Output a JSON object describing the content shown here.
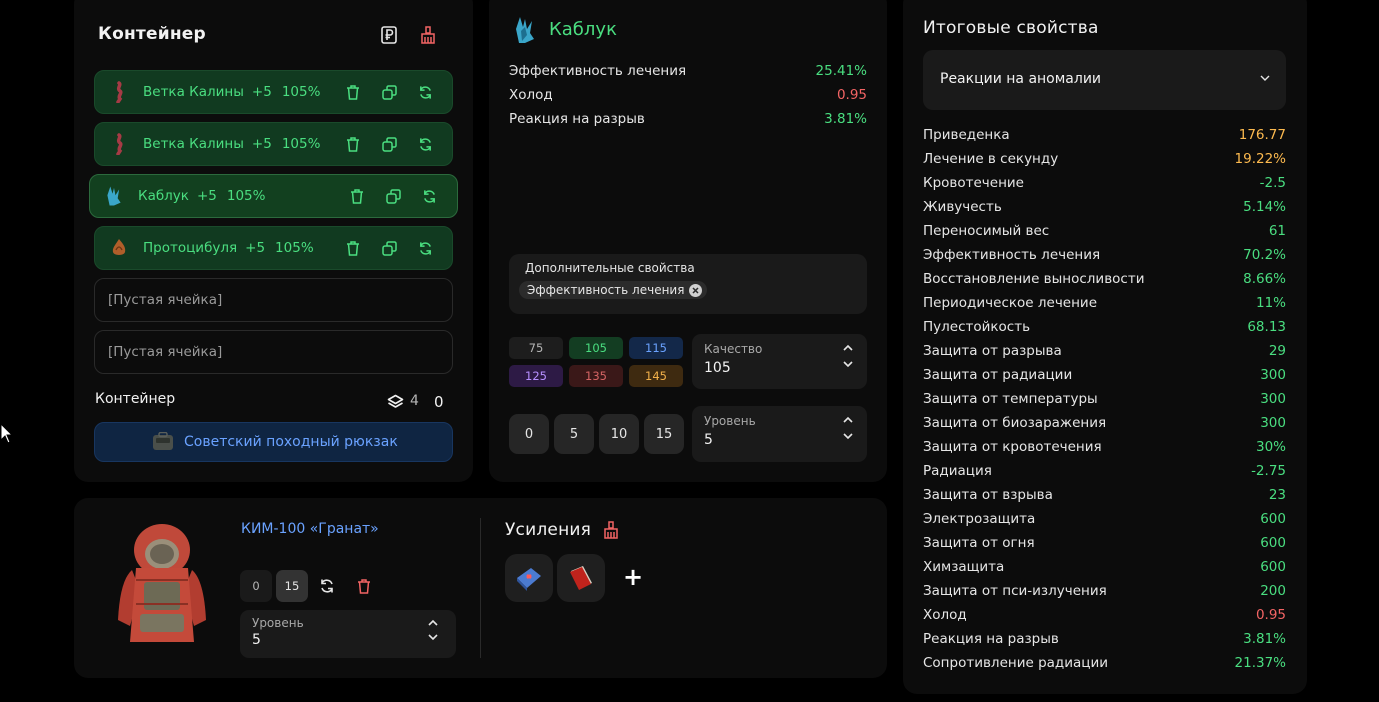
{
  "container": {
    "title": "Контейнер",
    "slots": [
      {
        "name": "Ветка Калины",
        "bonus": "+5",
        "quality": "105%",
        "icon": "branch-icon"
      },
      {
        "name": "Ветка Калины",
        "bonus": "+5",
        "quality": "105%",
        "icon": "branch-icon"
      },
      {
        "name": "Каблук",
        "bonus": "+5",
        "quality": "105%",
        "icon": "crystal-icon"
      },
      {
        "name": "Протоцибуля",
        "bonus": "+5",
        "quality": "105%",
        "icon": "bulb-icon"
      }
    ],
    "empty_slot_label": "[Пустая ячейка]",
    "footer_label": "Контейнер",
    "layers_count": "4",
    "extra_count": "0",
    "backpack_name": "Советский походный рюкзак"
  },
  "artifact": {
    "name": "Каблук",
    "stats": [
      {
        "label": "Эффективность лечения",
        "value": "25.41%",
        "color": "#4ade80"
      },
      {
        "label": "Холод",
        "value": "0.95",
        "color": "#f26464"
      },
      {
        "label": "Реакция на разрыв",
        "value": "3.81%",
        "color": "#4ade80"
      }
    ],
    "extra_props_title": "Дополнительные свойства",
    "extra_chip": "Эффективность лечения",
    "quality_options": [
      {
        "value": "75",
        "bg": "#1d1d1d",
        "color": "#b5b5b5"
      },
      {
        "value": "105",
        "bg": "#133d22",
        "color": "#4ade80"
      },
      {
        "value": "115",
        "bg": "#132849",
        "color": "#6aa2ff"
      },
      {
        "value": "125",
        "bg": "#2d1a45",
        "color": "#b890ff"
      },
      {
        "value": "135",
        "bg": "#3a1818",
        "color": "#d46464"
      },
      {
        "value": "145",
        "bg": "#3e2a10",
        "color": "#f2b04a"
      }
    ],
    "quality_label": "Качество",
    "quality_value": "105",
    "level_buttons": [
      "0",
      "5",
      "10",
      "15"
    ],
    "level_label": "Уровень",
    "level_value": "5"
  },
  "armor": {
    "name": "КИМ-100 «Гранат»",
    "level_min": "0",
    "level_max": "15",
    "level_label": "Уровень",
    "level_value": "5"
  },
  "boosts": {
    "title": "Усиления",
    "add_label": "+"
  },
  "summary": {
    "title": "Итоговые свойства",
    "dropdown_value": "Реакции на аномалии",
    "rows": [
      {
        "label": "Приведенка",
        "value": "176.77",
        "color": "#fdba4f"
      },
      {
        "label": "Лечение в секунду",
        "value": "19.22%",
        "color": "#fdba4f"
      },
      {
        "label": "Кровотечение",
        "value": "-2.5",
        "color": "#4ade80"
      },
      {
        "label": "Живучесть",
        "value": "5.14%",
        "color": "#4ade80"
      },
      {
        "label": "Переносимый вес",
        "value": "61",
        "color": "#4ade80"
      },
      {
        "label": "Эффективность лечения",
        "value": "70.2%",
        "color": "#4ade80"
      },
      {
        "label": "Восстановление выносливости",
        "value": "8.66%",
        "color": "#4ade80"
      },
      {
        "label": "Периодическое лечение",
        "value": "11%",
        "color": "#4ade80"
      },
      {
        "label": "Пулестойкость",
        "value": "68.13",
        "color": "#4ade80"
      },
      {
        "label": "Защита от разрыва",
        "value": "29",
        "color": "#4ade80"
      },
      {
        "label": "Защита от радиации",
        "value": "300",
        "color": "#4ade80"
      },
      {
        "label": "Защита от температуры",
        "value": "300",
        "color": "#4ade80"
      },
      {
        "label": "Защита от биозаражения",
        "value": "300",
        "color": "#4ade80"
      },
      {
        "label": "Защита от кровотечения",
        "value": "30%",
        "color": "#4ade80"
      },
      {
        "label": "Радиация",
        "value": "-2.75",
        "color": "#4ade80"
      },
      {
        "label": "Защита от взрыва",
        "value": "23",
        "color": "#4ade80"
      },
      {
        "label": "Электрозащита",
        "value": "600",
        "color": "#4ade80"
      },
      {
        "label": "Защита от огня",
        "value": "600",
        "color": "#4ade80"
      },
      {
        "label": "Химзащита",
        "value": "600",
        "color": "#4ade80"
      },
      {
        "label": "Защита от пси-излучения",
        "value": "200",
        "color": "#4ade80"
      },
      {
        "label": "Холод",
        "value": "0.95",
        "color": "#f26464"
      },
      {
        "label": "Реакция на разрыв",
        "value": "3.81%",
        "color": "#4ade80"
      },
      {
        "label": "Сопротивление радиации",
        "value": "21.37%",
        "color": "#4ade80"
      }
    ]
  }
}
